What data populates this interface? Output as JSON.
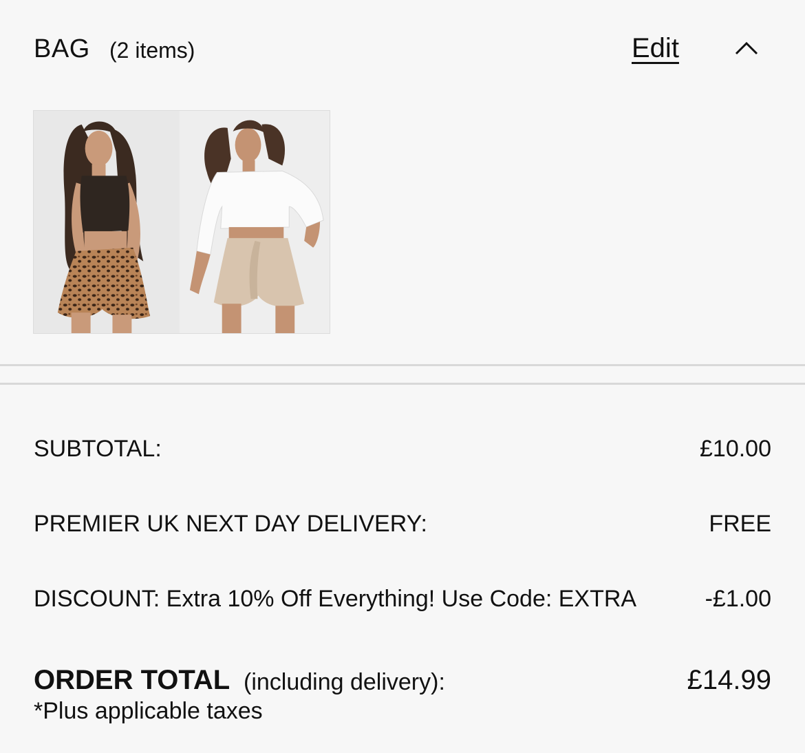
{
  "bag": {
    "title": "BAG",
    "count": "(2 items)",
    "edit_label": "Edit",
    "collapse_icon": "chevron-up-icon"
  },
  "items": [
    {
      "name": "product-image-leopard-shorts"
    },
    {
      "name": "product-image-beige-shorts"
    }
  ],
  "summary": {
    "subtotal_label": "SUBTOTAL:",
    "subtotal_value": "£10.00",
    "delivery_label": "PREMIER UK NEXT DAY DELIVERY:",
    "delivery_value": "FREE",
    "discount_label": "DISCOUNT: Extra 10% Off Everything! Use Code: EXTRA",
    "discount_value": "-£1.00",
    "total_label": "ORDER TOTAL",
    "total_sublabel": "(including delivery):",
    "total_value": "£14.99",
    "taxes_note": "*Plus applicable taxes"
  }
}
